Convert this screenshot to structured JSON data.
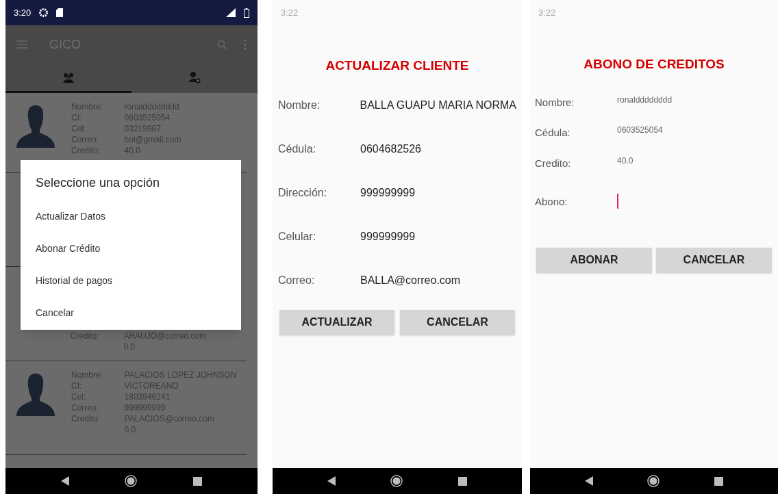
{
  "list_screen": {
    "status_bar": {
      "time": "3:20"
    },
    "app_bar": {
      "title": "GICO"
    },
    "tabs": [
      {
        "kind": "group",
        "selected": true
      },
      {
        "kind": "add-person",
        "selected": false
      }
    ],
    "clients": [
      {
        "labels": [
          "Nombre:",
          "CI:",
          "Cel:",
          "Correo:",
          "Credito:"
        ],
        "values": [
          "ronaldddddddd",
          "0603525054",
          "03219987",
          "hol@gmail.com",
          "40.0"
        ]
      },
      {
        "labels": [
          "Credito:"
        ],
        "values": [
          "ARAUJO@correo.com",
          "0.0"
        ]
      },
      {
        "labels": [
          "Nombre:",
          "CI:",
          "Cel:",
          "Correo:",
          "Credito:"
        ],
        "values": [
          "PALACIOS LOPEZ JOHNSON VICTOREANO",
          "1803946241",
          "999999999",
          "PALACIOS@correo.com",
          "0.0"
        ]
      }
    ],
    "dialog": {
      "title": "Seleccione una opción",
      "options": [
        "Actualizar Datos",
        "Abonar Crédito",
        "Historial de pagos",
        "Cancelar"
      ]
    }
  },
  "update_screen": {
    "status_bar": {
      "time": "3:22"
    },
    "title": "ACTUALIZAR CLIENTE",
    "fields": [
      {
        "label": "Nombre:",
        "value": "BALLA GUAPU MARIA NORMA"
      },
      {
        "label": "Cédula:",
        "value": "0604682526"
      },
      {
        "label": "Dirección:",
        "value": "999999999"
      },
      {
        "label": "Celular:",
        "value": "999999999"
      },
      {
        "label": "Correo:",
        "value": "BALLA@correo.com"
      }
    ],
    "buttons": [
      "ACTUALIZAR",
      "CANCELAR"
    ]
  },
  "payment_screen": {
    "status_bar": {
      "time": "3:22"
    },
    "title": "ABONO DE CREDITOS",
    "fields": [
      {
        "label": "Nombre:",
        "value": "ronaldddddddd",
        "kind": "text"
      },
      {
        "label": "Cédula:",
        "value": "0603525054",
        "kind": "text"
      },
      {
        "label": "Credito:",
        "value": "40.0",
        "kind": "text"
      },
      {
        "label": "Abono:",
        "kind": "input"
      }
    ],
    "buttons": [
      "ABONAR",
      "CANCELAR"
    ]
  }
}
